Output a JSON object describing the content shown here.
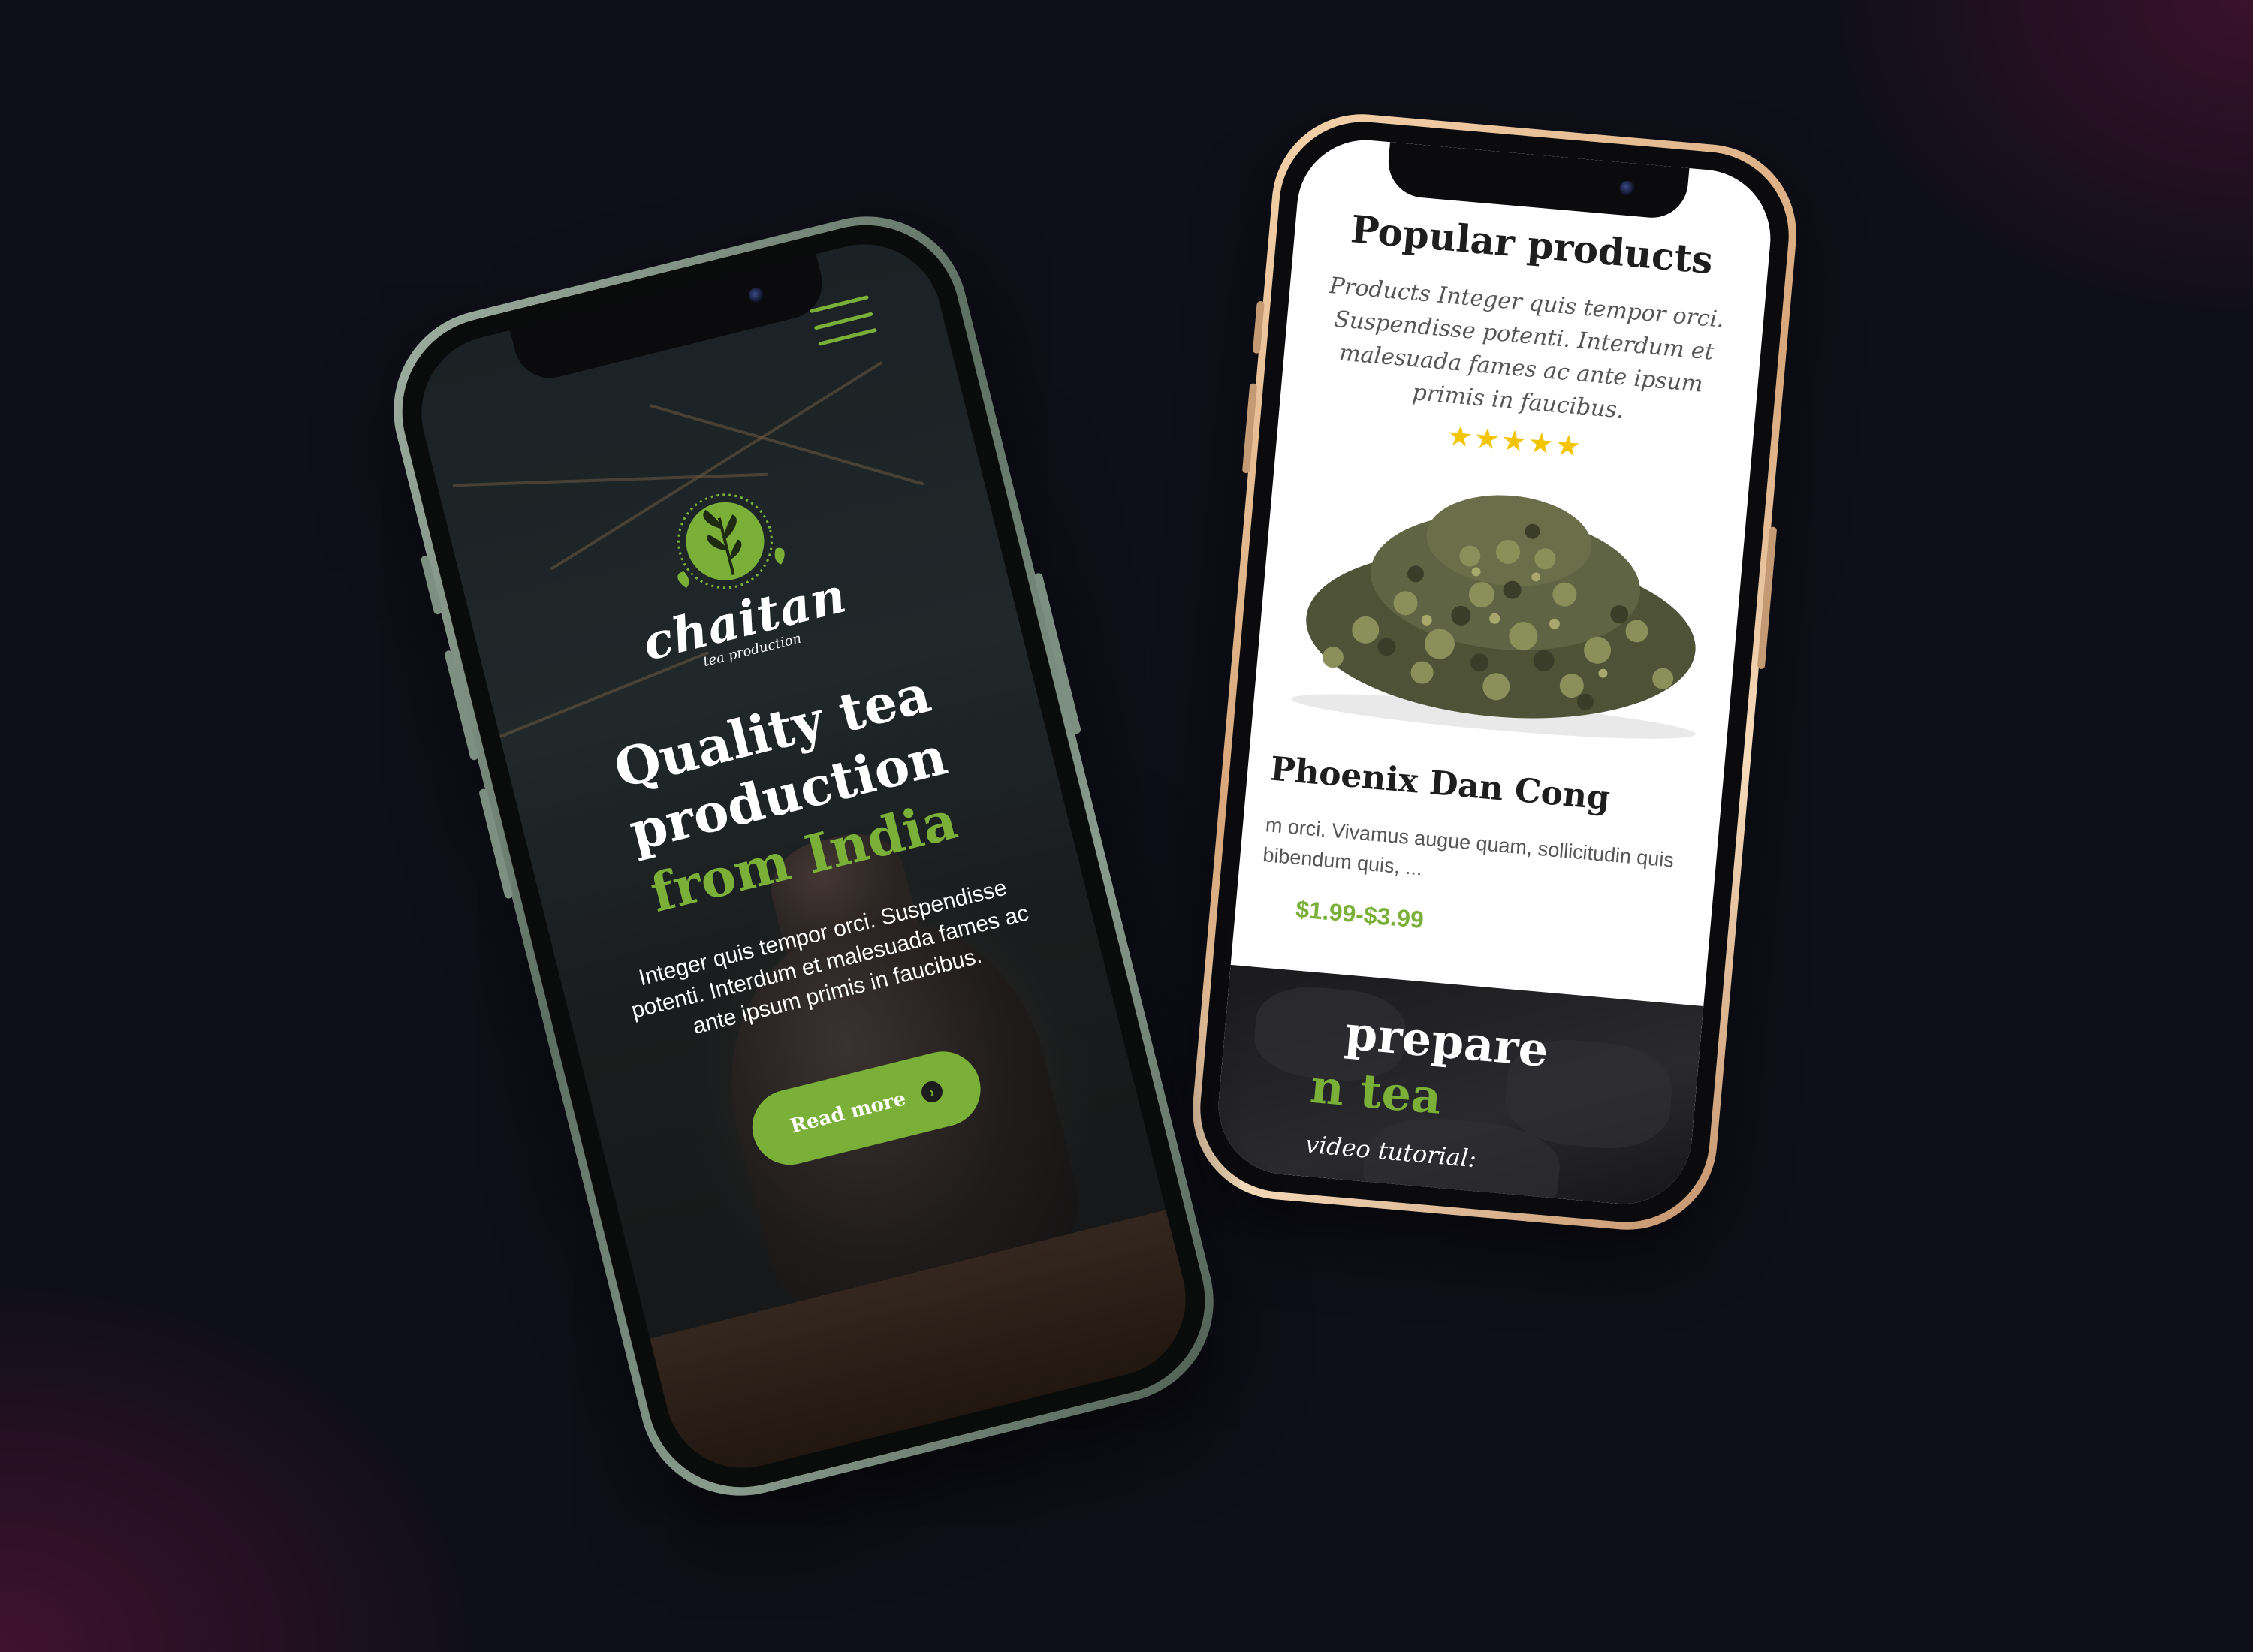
{
  "back_phone": {
    "section_title": "Popular products",
    "section_description": "Products Integer quis tempor orci. Suspendisse potenti. Interdum et malesuada fames ac ante ipsum primis in faucibus.",
    "product": {
      "rating": "★★★★★",
      "rating_value": 5,
      "name": "Phoenix Dan Cong",
      "description": "m orci. Vivamus augue quam, sollicitudin quis bibendum quis, ...",
      "price": "$1.99-$3.99"
    },
    "video_section": {
      "title_line1": "prepare",
      "title_line2": "n tea",
      "subtitle": "video tutorial:"
    }
  },
  "front_phone": {
    "brand": "chaitan",
    "brand_tagline": "tea production",
    "headline_white": "Quality tea production ",
    "headline_green": "from India",
    "hero_text": "Integer quis tempor orci. Suspendisse potenti. Interdum et malesuada fames ac ante ipsum primis in faucibus.",
    "cta_label": "Read more"
  },
  "colors": {
    "accent_green": "#7ab037",
    "star_yellow": "#f3c400",
    "background": "#0f0f19",
    "gold_frame": "#d7a67a",
    "sage_frame": "#5d6f62"
  },
  "icons": {
    "menu": "hamburger-icon",
    "cta_arrow": "chevron-right-icon",
    "logo": "tea-leaf-icon"
  }
}
